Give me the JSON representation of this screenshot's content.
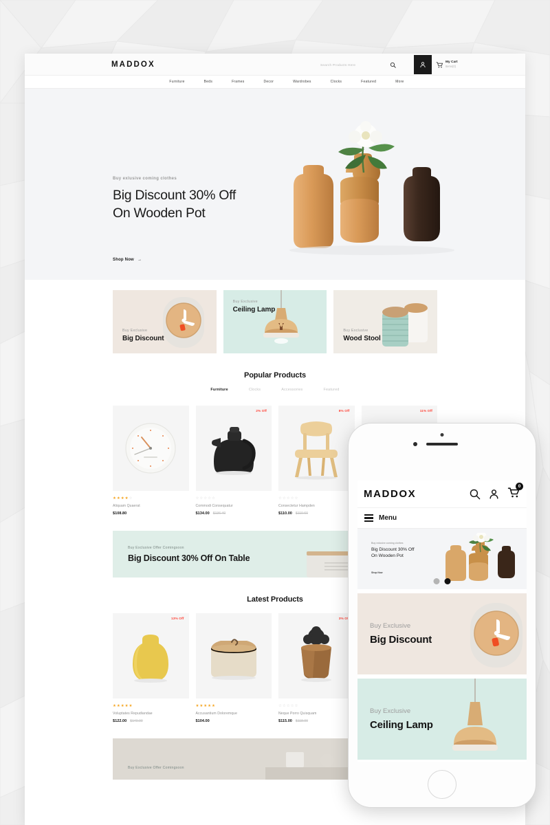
{
  "brand": {
    "name": "MADDOX",
    "accent": "#ff4438"
  },
  "desktop": {
    "header": {
      "logo": "MADDOX",
      "search_placeholder": "Search Products Here",
      "search_icon": "search-icon",
      "user_icon": "user-icon",
      "cart_icon": "cart-icon",
      "cart_title": "My Cart",
      "cart_sub": "Items(0)"
    },
    "nav": [
      {
        "label": "Furniture"
      },
      {
        "label": "Beds"
      },
      {
        "label": "Frames"
      },
      {
        "label": "Decor"
      },
      {
        "label": "Wardrobes"
      },
      {
        "label": "Clocks"
      },
      {
        "label": "Featured"
      },
      {
        "label": "More"
      }
    ],
    "hero": {
      "eyebrow": "Buy exlusive coming clothes",
      "title_line1": "Big Discount 30% Off",
      "title_line2": "On Wooden Pot",
      "cta": "Shop Now",
      "cta_arrow": "→"
    },
    "banners": [
      {
        "eyebrow": "Buy Exclusive",
        "title": "Big Discount",
        "bg": "#efe7e0",
        "align": "bottom"
      },
      {
        "eyebrow": "Buy Exclusive",
        "title": "Ceiling Lamp",
        "bg": "#d7ece6",
        "align": "top"
      },
      {
        "eyebrow": "Buy Exclusive",
        "title": "Wood Stool",
        "bg": "#f0ece6",
        "align": "bottom"
      }
    ],
    "popular": {
      "title": "Popular Products",
      "tabs": [
        {
          "label": "Furniture",
          "active": true
        },
        {
          "label": "Clocks",
          "active": false
        },
        {
          "label": "Accessories",
          "active": false
        },
        {
          "label": "Featured",
          "active": false
        }
      ],
      "products": [
        {
          "name": "Aliquam Quaerat",
          "price": "$108.80",
          "old_price": "",
          "badge": "",
          "rating": 4
        },
        {
          "name": "Commodi Consequatur",
          "price": "$134.00",
          "old_price": "$136.40",
          "badge": "2% Off",
          "rating": 0
        },
        {
          "name": "Consectetur Hampden",
          "price": "$110.00",
          "old_price": "$119.60",
          "badge": "8% Off",
          "rating": 0
        },
        {
          "name": "",
          "price": "",
          "old_price": "",
          "badge": "11% Off",
          "rating": 0
        }
      ]
    },
    "offer": {
      "eyebrow": "Buy Exclusive Offer Comingsoon",
      "title": "Big Discount 30% Off On Table"
    },
    "latest": {
      "title": "Latest Products",
      "products": [
        {
          "name": "Voluptates Repudiandae",
          "price": "$122.00",
          "old_price": "$140.00",
          "badge": "13% Off",
          "rating": 5
        },
        {
          "name": "Accusantium Doloremque",
          "price": "$104.00",
          "old_price": "",
          "badge": "",
          "rating": 5
        },
        {
          "name": "Neque Porro Quisquam",
          "price": "$115.00",
          "old_price": "$118.00",
          "badge": "3% Off",
          "rating": 0
        }
      ]
    },
    "bottom_offer": {
      "eyebrow": "Buy Exclusive Offer Comingsoon"
    }
  },
  "mobile": {
    "header": {
      "logo": "MADDOX",
      "search_icon": "search-icon",
      "user_icon": "user-icon",
      "cart_icon": "cart-icon",
      "cart_count": "0"
    },
    "menu_label": "Menu",
    "hero": {
      "eyebrow": "Buy exlusive coming clothes",
      "title_line1": "Big Discount 30% Off",
      "title_line2": "On Wooden Pot",
      "cta": "Shop Now"
    },
    "carousel": {
      "dots": 2,
      "active_index": 1
    },
    "banners": [
      {
        "eyebrow": "Buy Exclusive",
        "title": "Big Discount",
        "bg": "#efe7e0"
      },
      {
        "eyebrow": "Buy Exclusive",
        "title": "Ceiling Lamp",
        "bg": "#d7ece6"
      }
    ]
  }
}
